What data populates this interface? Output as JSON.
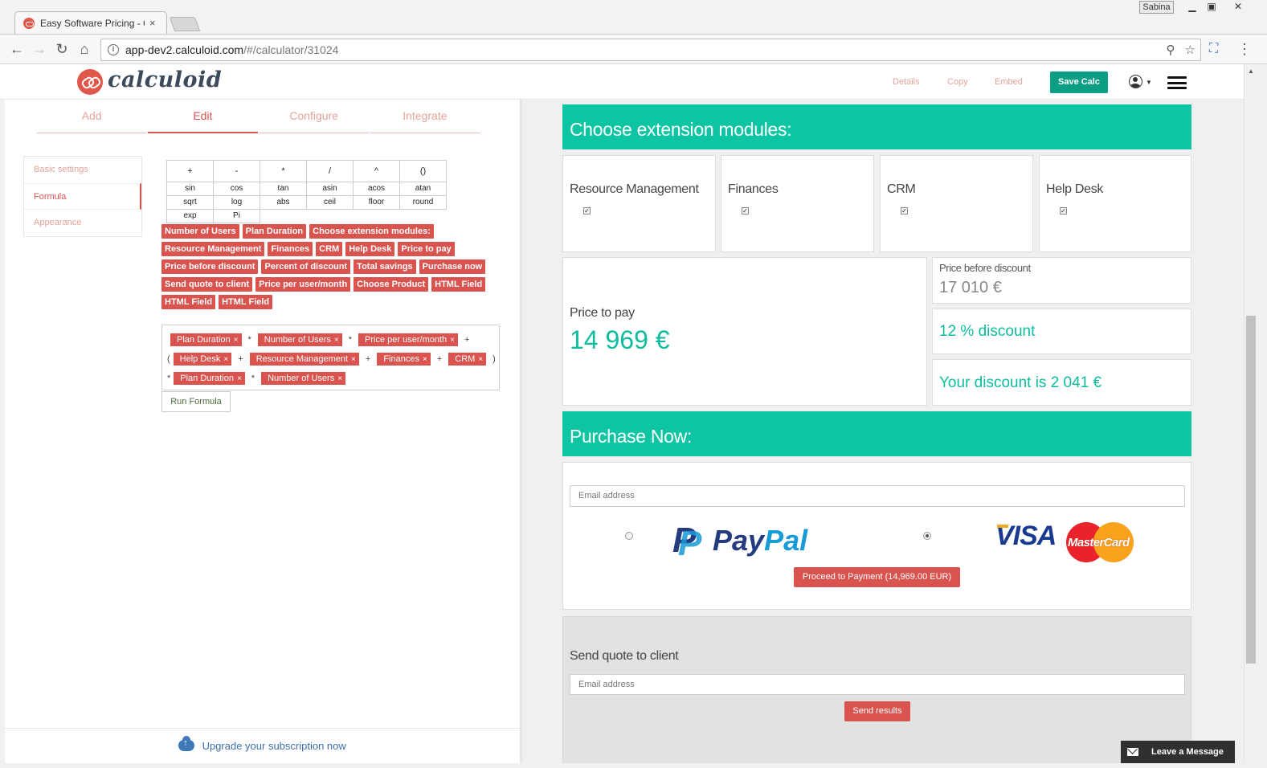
{
  "browser": {
    "tab_title": "Easy Software Pricing - C",
    "tab_close": "×",
    "user_badge": "Sabina",
    "url_host": "app-dev2.calculoid.com",
    "url_path": "/#/calculator/31024",
    "window_controls": [
      "minimize-icon",
      "restore-icon",
      "close-icon"
    ]
  },
  "app": {
    "logo_text": "calculoid",
    "header_links": {
      "details": "Details",
      "copy": "Copy",
      "embed": "Embed"
    },
    "save_button": "Save Calc",
    "accent_color": "#d9534f",
    "teal_color": "#0dc4a3"
  },
  "editor": {
    "tabs": [
      {
        "label": "Add"
      },
      {
        "label": "Edit",
        "active": true
      },
      {
        "label": "Configure"
      },
      {
        "label": "Integrate"
      }
    ],
    "side_menu": [
      {
        "label": "Basic settings"
      },
      {
        "label": "Formula",
        "active": true
      },
      {
        "label": "Appearance"
      }
    ],
    "operators": [
      "+",
      "-",
      "*",
      "/",
      "^",
      "()"
    ],
    "functions_row1": [
      "sin",
      "cos",
      "tan",
      "asin",
      "acos",
      "atan"
    ],
    "functions_row2": [
      "sqrt",
      "log",
      "abs",
      "ceil",
      "floor",
      "round"
    ],
    "functions_row3": [
      "exp",
      "Pi"
    ],
    "field_chips": [
      "Number of Users",
      "Plan Duration",
      "Choose extension modules:",
      "Resource Management",
      "Finances",
      "CRM",
      "Help Desk",
      "Price to pay",
      "Price before discount",
      "Percent of discount",
      "Total savings",
      "Purchase now",
      "Send quote to client",
      "Price per user/month",
      "Choose Product",
      "HTML Field",
      "HTML Field",
      "HTML Field"
    ],
    "formula": {
      "t1": "Plan Duration",
      "t2": "Number of Users",
      "t3": "Price per user/month",
      "t4": "Help Desk",
      "t5": "Resource Management",
      "t6": "Finances",
      "t7": "CRM",
      "t8": "Plan Duration",
      "t9": "Number of Users",
      "op_mul": "*",
      "op_plus": "+",
      "open_paren": "(",
      "close_paren": ")",
      "remove": "×"
    },
    "run_button": "Run Formula",
    "upgrade_text": "Upgrade your subscription now"
  },
  "preview": {
    "modules_title": "Choose extension modules:",
    "modules": [
      {
        "label": "Resource Management",
        "checked": true
      },
      {
        "label": "Finances",
        "checked": true
      },
      {
        "label": "CRM",
        "checked": true
      },
      {
        "label": "Help Desk",
        "checked": true
      }
    ],
    "check_mark": "✓",
    "price_to_pay_label": "Price to pay",
    "price_to_pay_value": "14 969 €",
    "price_before_label": "Price before discount",
    "price_before_value": "17 010 €",
    "discount_text": "12 % discount",
    "savings_text": "Your discount is 2 041 €",
    "purchase_title": "Purchase Now:",
    "email_placeholder": "Email address",
    "payment_options": [
      {
        "name": "PayPal",
        "selected": false
      },
      {
        "name": "VISA MasterCard",
        "selected": true
      }
    ],
    "paypal_pay": "Pay",
    "paypal_pal": "Pal",
    "visa_text": "VISA",
    "mastercard_text": "MasterCard",
    "proceed_button": "Proceed to Payment (14,969.00 EUR)",
    "quote_label": "Send quote to client",
    "quote_email_placeholder": "Email address",
    "send_button": "Send results"
  },
  "chat": {
    "label": "Leave a Message"
  }
}
